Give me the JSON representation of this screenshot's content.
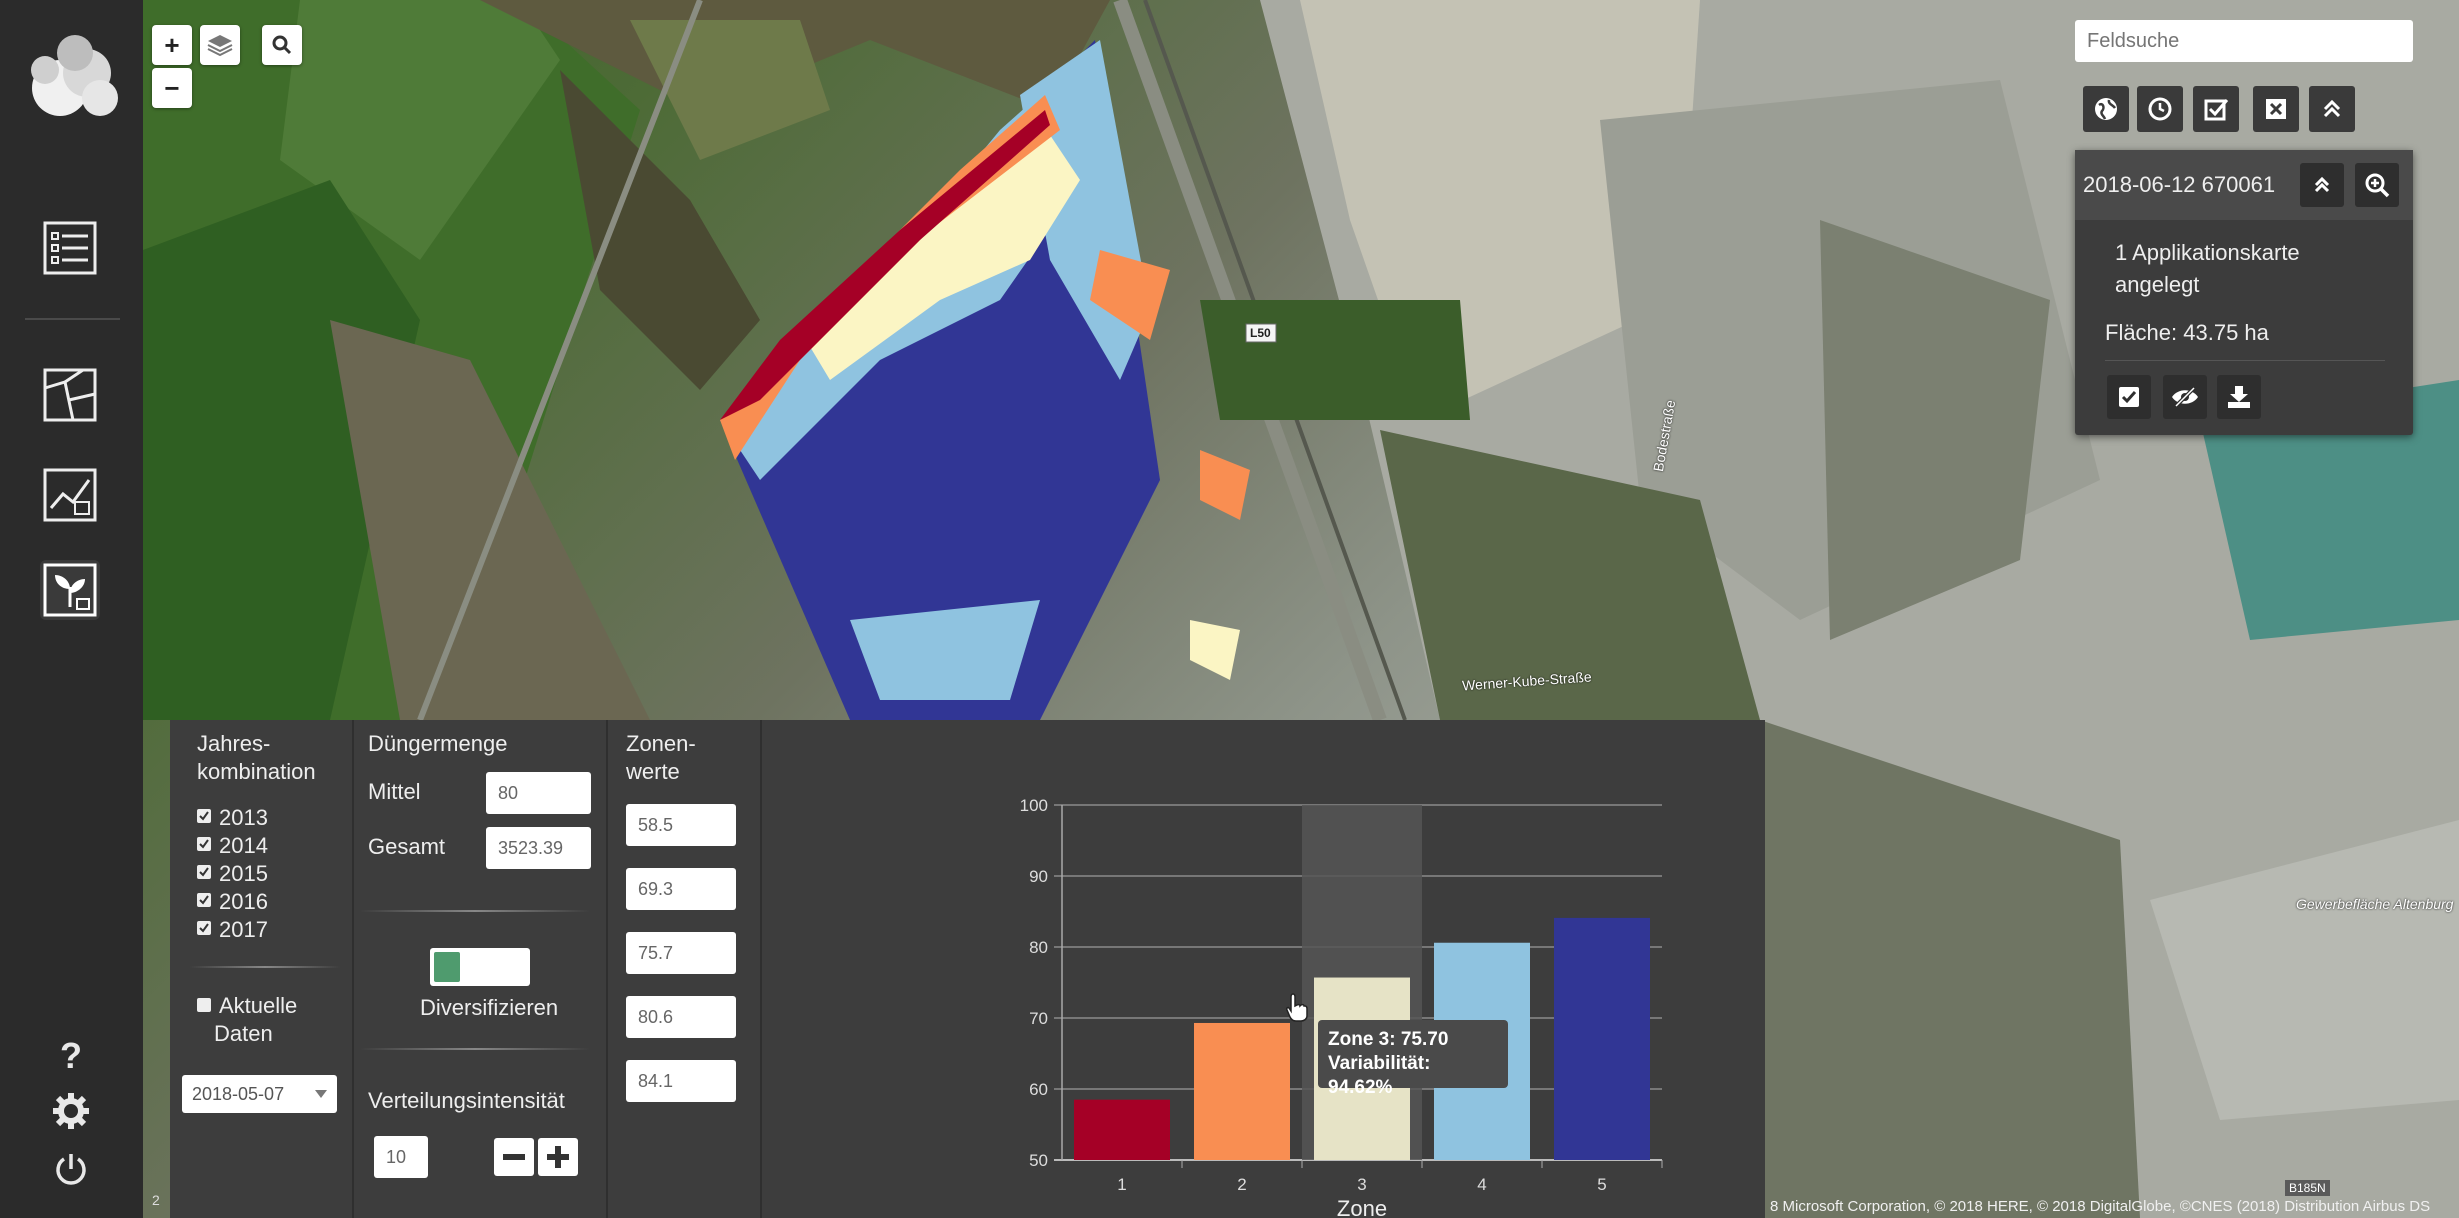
{
  "map": {
    "road_label_l50": "L50",
    "street_werner": "Werner-Kube-Straße",
    "street_bode": "Bodestraße",
    "area_label": "Gewerbefläche Altenburg",
    "road_b185": "B185N",
    "copyright": "8 Microsoft Corporation, © 2018 HERE, © 2018 DigitalGlobe, ©CNES (2018) Distribution Airbus DS",
    "attrib_left": "2",
    "zone_colors": [
      "#a50026",
      "#f98e52",
      "#fbf5c4",
      "#8fc3e0",
      "#313695"
    ]
  },
  "map_controls": {
    "zoom_in": "+",
    "zoom_out": "−"
  },
  "search": {
    "placeholder": "Feldsuche"
  },
  "info": {
    "title": "2018-06-12 670061",
    "line1": "1 Applikationskarte",
    "line2": "angelegt",
    "area": "Fläche: 43.75 ha"
  },
  "bottom": {
    "jahres": {
      "title1": "Jahres-",
      "title2": "kombination",
      "years": [
        "2013",
        "2014",
        "2015",
        "2016",
        "2017"
      ],
      "aktuelle1": "Aktuelle",
      "aktuelle2": "Daten",
      "date_select": "2018-05-07"
    },
    "duenger": {
      "title": "Düngermenge",
      "mittel_label": "Mittel",
      "mittel_value": "80",
      "gesamt_label": "Gesamt",
      "gesamt_value": "3523.39",
      "diversify": "Diversifizieren",
      "verteilung": "Verteilungsintensität",
      "verteilung_value": "10"
    },
    "zonen": {
      "title1": "Zonen-",
      "title2": "werte",
      "values": [
        "58.5",
        "69.3",
        "75.7",
        "80.6",
        "84.1"
      ]
    }
  },
  "sidebar_help": "?",
  "chart_data": {
    "type": "bar",
    "categories": [
      "1",
      "2",
      "3",
      "4",
      "5"
    ],
    "values": [
      58.5,
      69.3,
      75.7,
      80.6,
      84.1
    ],
    "colors": [
      "#a50026",
      "#f98e52",
      "#e6e3c6",
      "#8fc3e0",
      "#313695"
    ],
    "xlabel": "Zone",
    "ylabel": "",
    "ylim": [
      50,
      100
    ],
    "yticks": [
      "50",
      "60",
      "70",
      "80",
      "90",
      "100"
    ],
    "grid": true,
    "highlight_index": 2,
    "tooltip": {
      "line1": "Zone 3: 75.70",
      "line2": "Variabilität: 94.62%"
    }
  }
}
